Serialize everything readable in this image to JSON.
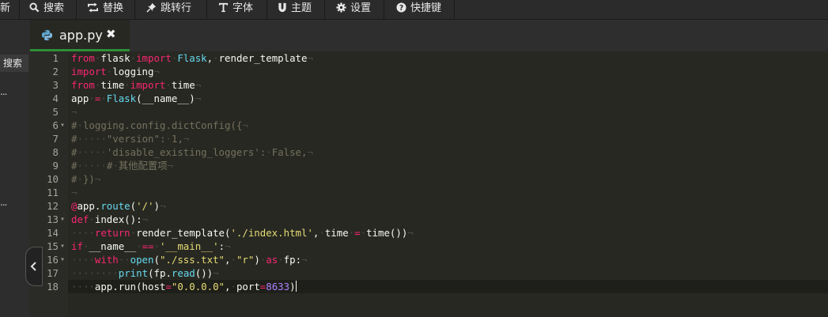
{
  "toolbar": {
    "items": [
      {
        "label": "新",
        "icon": "none"
      },
      {
        "label": "搜索",
        "icon": "search-icon"
      },
      {
        "label": "替换",
        "icon": "replace-icon"
      },
      {
        "label": "跳转行",
        "icon": "pin-icon"
      },
      {
        "label": "字体",
        "icon": "text-icon"
      },
      {
        "label": "主题",
        "icon": "magnet-icon"
      },
      {
        "label": "设置",
        "icon": "gear-icon"
      },
      {
        "label": "快捷键",
        "icon": "info-icon"
      }
    ]
  },
  "sidebar": {
    "search_label": "搜索",
    "ellipsis_1": "...",
    "ellipsis_2": "...",
    "collapse_icon": "chevron-left-icon"
  },
  "tab": {
    "filename": "app.py",
    "file_icon": "python-icon",
    "close": "✖"
  },
  "editor": {
    "whitespace_marks": {
      "space": "·",
      "eol": "¬"
    },
    "colors": {
      "keyword": "#f92672",
      "function": "#66d9ef",
      "string": "#e6db74",
      "number": "#ae81ff",
      "comment": "#75715e",
      "tab_underline": "#2f8f37"
    },
    "lines": [
      {
        "n": "1",
        "text": "from flask import Flask, render_template"
      },
      {
        "n": "2",
        "text": "import logging"
      },
      {
        "n": "3",
        "text": "from time import time"
      },
      {
        "n": "4",
        "text": "app = Flask(__name__)"
      },
      {
        "n": "5",
        "text": ""
      },
      {
        "n": "6",
        "text": "# logging.config.dictConfig({"
      },
      {
        "n": "7",
        "text": "#     \"version\": 1,"
      },
      {
        "n": "8",
        "text": "#     'disable_existing_loggers': False,"
      },
      {
        "n": "9",
        "text": "#     # 其他配置项"
      },
      {
        "n": "10",
        "text": "# })"
      },
      {
        "n": "11",
        "text": ""
      },
      {
        "n": "12",
        "text": "@app.route('/')"
      },
      {
        "n": "13",
        "text": "def index():"
      },
      {
        "n": "14",
        "text": "    return render_template('./index.html', time = time())"
      },
      {
        "n": "15",
        "text": "if __name__ == '__main__':"
      },
      {
        "n": "16",
        "text": "    with  open(\"./sss.txt\", \"r\") as fp:"
      },
      {
        "n": "17",
        "text": "        print(fp.read())"
      },
      {
        "n": "18",
        "text": "    app.run(host=\"0.0.0.0\", port=8633)"
      }
    ],
    "fold_markers": [
      "6",
      "13",
      "15",
      "16"
    ]
  }
}
